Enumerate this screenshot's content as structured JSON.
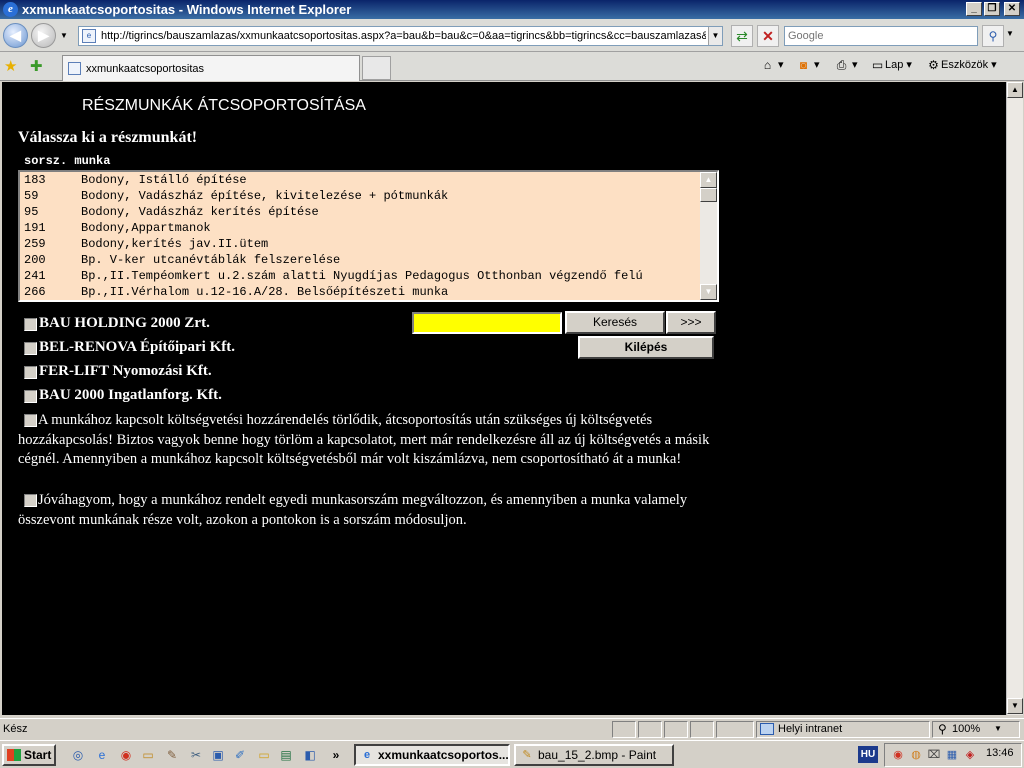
{
  "window": {
    "title": "xxmunkaatcsoportositas - Windows Internet Explorer",
    "minimize": "_",
    "restore": "❐",
    "close": "✕"
  },
  "address": {
    "url": "http://tigrincs/bauszamlazas/xxmunkaatcsoportositas.aspx?a=bau&b=bau&c=0&aa=tigrincs&bb=tigrincs&cc=bauszamlazas&",
    "search_placeholder": "Google"
  },
  "tab": {
    "label": "xxmunkaatcsoportositas"
  },
  "toolbar": {
    "page_label": "Lap",
    "tools_label": "Eszközök"
  },
  "page": {
    "title": "RÉSZMUNKÁK ÁTCSOPORTOSÍTÁSA",
    "prompt": "Válassza ki a részmunkát!",
    "column_header": "sorsz. munka",
    "items": [
      {
        "num": "183",
        "text": "Bodony, Istálló építése"
      },
      {
        "num": "59",
        "text": "Bodony, Vadászház építése, kivitelezése + pótmunkák"
      },
      {
        "num": "95",
        "text": "Bodony, Vadászház kerítés építése"
      },
      {
        "num": "191",
        "text": "Bodony,Appartmanok"
      },
      {
        "num": "259",
        "text": "Bodony,kerítés jav.II.ütem"
      },
      {
        "num": "200",
        "text": "Bp. V-ker utcanévtáblák felszerelése"
      },
      {
        "num": "241",
        "text": "Bp.,II.Tempéomkert u.2.szám alatti Nyugdíjas Pedagogus Otthonban végzendő felú"
      },
      {
        "num": "266",
        "text": "Bp.,II.Vérhalom u.12-16.A/28. Belsőépítészeti munka"
      }
    ],
    "companies": [
      "BAU HOLDING 2000 Zrt.",
      "BEL-RENOVA Építőipari Kft.",
      "FER-LIFT Nyomozási Kft.",
      "BAU 2000 Ingatlanforg. Kft."
    ],
    "search_value": "",
    "search_button": "Keresés",
    "next_button": ">>>",
    "exit_button": "Kilépés",
    "confirm1": "A munkához kapcsolt költségvetési hozzárendelés törlődik, átcsoportosítás után szükséges új költségvetés hozzákapcsolás! Biztos vagyok benne hogy törlöm a kapcsolatot, mert már rendelkezésre áll az új költségvetés a másik cégnél. Amennyiben a munkához kapcsolt költségvetésből már volt kiszámlázva, nem csoportosítható át a munka!",
    "confirm2": "Jóváhagyom, hogy a munkához rendelt egyedi munkasorszám megváltozzon, és amennyiben a munka valamely összevont munkának része volt, azokon a pontokon is a sorszám módosuljon."
  },
  "status": {
    "text": "Kész",
    "zone": "Helyi intranet",
    "zoom": "100%"
  },
  "taskbar": {
    "start": "Start",
    "tasks": [
      "xxmunkaatcsoportos...",
      "bau_15_2.bmp - Paint"
    ],
    "language": "HU",
    "time": "13:46"
  }
}
